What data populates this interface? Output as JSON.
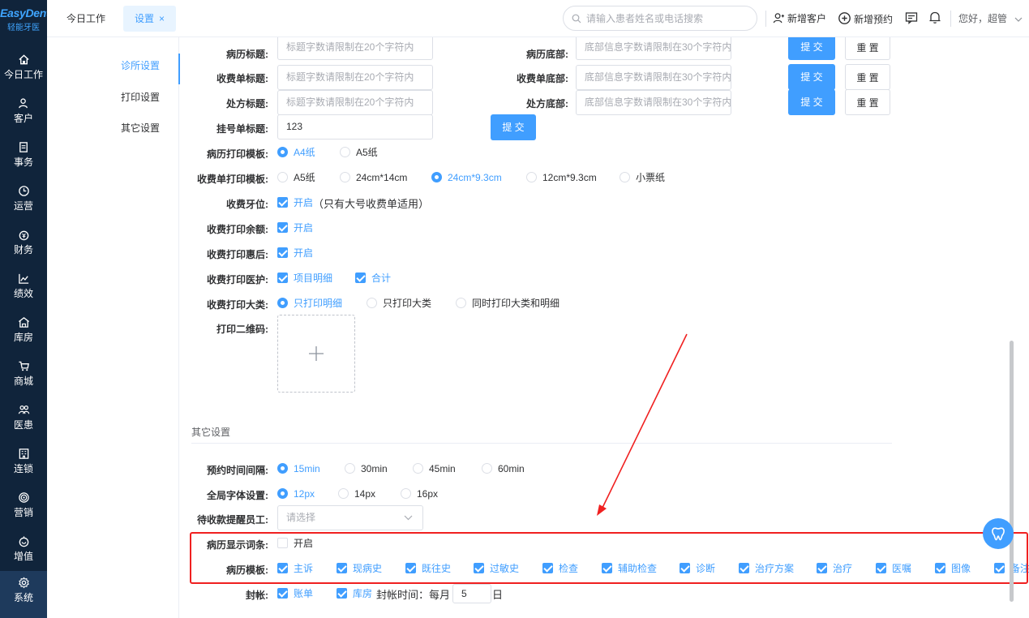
{
  "logo": {
    "brand": "EasyDent",
    "sub": "轻能牙医"
  },
  "nav": {
    "items": [
      {
        "label": "今日工作",
        "icon": "home-icon"
      },
      {
        "label": "客户",
        "icon": "user-icon"
      },
      {
        "label": "事务",
        "icon": "document-icon"
      },
      {
        "label": "运营",
        "icon": "clock-icon"
      },
      {
        "label": "财务",
        "icon": "money-icon"
      },
      {
        "label": "绩效",
        "icon": "chart-icon"
      },
      {
        "label": "库房",
        "icon": "warehouse-icon"
      },
      {
        "label": "商城",
        "icon": "cart-icon"
      },
      {
        "label": "医患",
        "icon": "people-icon"
      },
      {
        "label": "连锁",
        "icon": "building-icon"
      },
      {
        "label": "营销",
        "icon": "target-icon"
      },
      {
        "label": "增值",
        "icon": "gift-icon"
      },
      {
        "label": "系统",
        "icon": "gear-icon"
      }
    ],
    "active": "系统"
  },
  "topbar": {
    "tabs": [
      {
        "label": "今日工作"
      },
      {
        "label": "设置",
        "close": "×"
      }
    ],
    "search_placeholder": "请输入患者姓名或电话搜索",
    "new_customer": "新增客户",
    "new_appointment": "新增预约",
    "greeting": "您好，超管"
  },
  "subnav": {
    "items": [
      "诊所设置",
      "打印设置",
      "其它设置"
    ],
    "active": "诊所设置"
  },
  "print": {
    "row0": {
      "left_label": "病历标题:",
      "left_placeholder": "标题字数请限制在20个字符内",
      "right_label": "病历底部:",
      "right_placeholder": "底部信息字数请限制在30个字符内",
      "submit": "提 交",
      "reset": "重 置"
    },
    "row1": {
      "left_label": "收费单标题:",
      "left_placeholder": "标题字数请限制在20个字符内",
      "right_label": "收费单底部:",
      "right_placeholder": "底部信息字数请限制在30个字符内",
      "submit": "提 交",
      "reset": "重 置"
    },
    "row2": {
      "left_label": "处方标题:",
      "left_placeholder": "标题字数请限制在20个字符内",
      "right_label": "处方底部:",
      "right_placeholder": "底部信息字数请限制在30个字符内",
      "submit": "提 交",
      "reset": "重 置"
    },
    "registration": {
      "label": "挂号单标题:",
      "value": "123",
      "submit": "提 交"
    },
    "record_template": {
      "label": "病历打印模板:",
      "options": [
        "A4纸",
        "A5纸"
      ],
      "selected": "A4纸"
    },
    "receipt_template": {
      "label": "收费单打印模板:",
      "options": [
        "A5纸",
        "24cm*14cm",
        "24cm*9.3cm",
        "12cm*9.3cm",
        "小票纸"
      ],
      "selected": "24cm*9.3cm"
    },
    "tooth_position": {
      "label": "收费牙位:",
      "option": "开启",
      "note": "（只有大号收费单适用）",
      "checked": true
    },
    "balance": {
      "label": "收费打印余额:",
      "option": "开启",
      "checked": true
    },
    "discount": {
      "label": "收费打印惠后:",
      "option": "开启",
      "checked": true
    },
    "nurse": {
      "label": "收费打印医护:",
      "options": [
        "项目明细",
        "合计"
      ],
      "checked": [
        true,
        true
      ]
    },
    "category": {
      "label": "收费打印大类:",
      "options": [
        "只打印明细",
        "只打印大类",
        "同时打印大类和明细"
      ],
      "selected": "只打印明细"
    },
    "qrcode": {
      "label": "打印二维码:"
    }
  },
  "other": {
    "title": "其它设置",
    "interval": {
      "label": "预约时间间隔:",
      "options": [
        "15min",
        "30min",
        "45min",
        "60min"
      ],
      "selected": "15min"
    },
    "font_size": {
      "label": "全局字体设置:",
      "options": [
        "12px",
        "14px",
        "16px"
      ],
      "selected": "12px"
    },
    "reminder": {
      "label": "待收款提醒员工:",
      "placeholder": "请选择"
    },
    "record_terms": {
      "label": "病历显示词条:",
      "option": "开启",
      "checked": false
    },
    "record_template": {
      "label": "病历模板:",
      "options": [
        "主诉",
        "现病史",
        "既往史",
        "过敏史",
        "检查",
        "辅助检查",
        "诊断",
        "治疗方案",
        "治疗",
        "医嘱",
        "图像",
        "备注"
      ]
    },
    "closing": {
      "label": "封帐:",
      "options": [
        "账单",
        "库房"
      ],
      "time_label": "封帐时间：每月",
      "day": "5",
      "unit": "日"
    }
  },
  "colors": {
    "primary": "#409eff",
    "sidebar": "#10243b",
    "annotation": "#f02020"
  }
}
